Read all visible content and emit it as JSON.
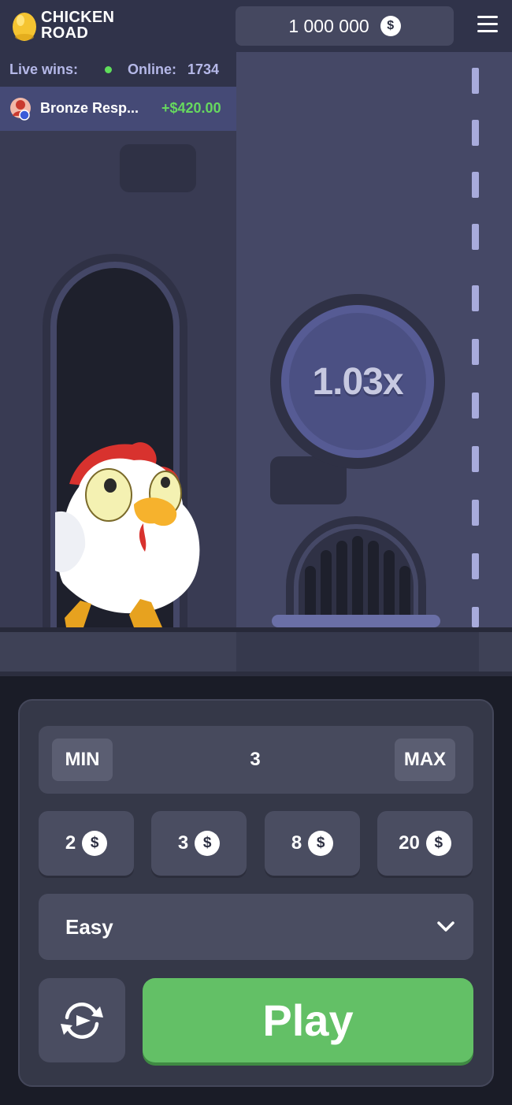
{
  "header": {
    "logo_line1": "CHICKEN",
    "logo_line2": "ROAD",
    "balance": "1 000 000",
    "currency_symbol": "$",
    "logo_egg_color": "#f5c431",
    "menu_icon": "hamburger-menu-icon"
  },
  "live_wins": {
    "label": "Live wins:",
    "online_label": "Online:",
    "online_count": "1734",
    "online_dot_color": "#5fde5b",
    "latest_win": {
      "player": "Bronze Resp...",
      "amount": "+$420.00",
      "amount_color": "#67d85f"
    }
  },
  "game": {
    "multiplier": "1.03x"
  },
  "controls": {
    "min_label": "MIN",
    "max_label": "MAX",
    "bet_value": "3",
    "quick_bets": [
      {
        "amount": "2",
        "currency": "$"
      },
      {
        "amount": "3",
        "currency": "$"
      },
      {
        "amount": "8",
        "currency": "$"
      },
      {
        "amount": "20",
        "currency": "$"
      }
    ],
    "difficulty": "Easy",
    "auto_icon": "auto-refresh-icon",
    "play_label": "Play",
    "play_color": "#63c066"
  }
}
